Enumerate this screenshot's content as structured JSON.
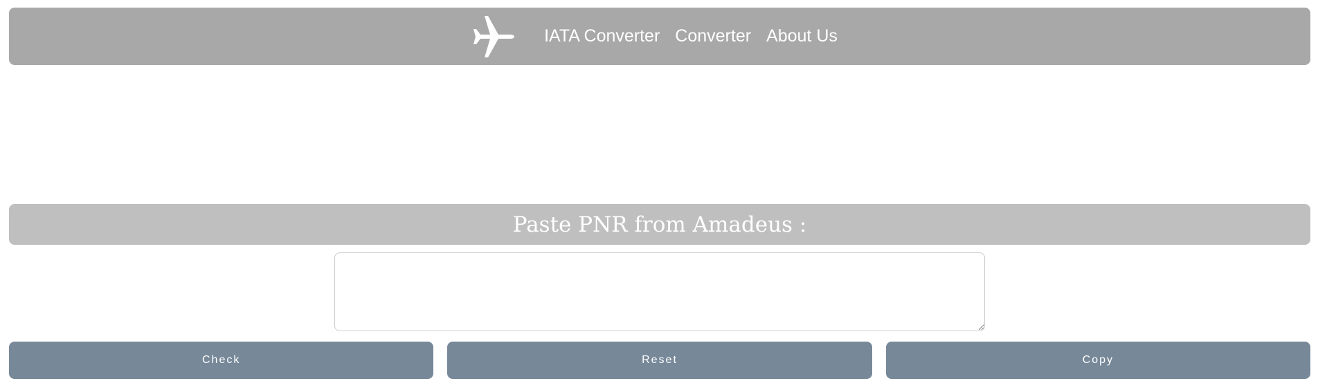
{
  "navbar": {
    "logo_icon": "airplane-icon",
    "links": [
      {
        "label": "IATA Converter"
      },
      {
        "label": "Converter"
      },
      {
        "label": "About Us"
      }
    ]
  },
  "section": {
    "title": "Paste PNR from Amadeus :"
  },
  "pnr_input": {
    "value": "",
    "placeholder": ""
  },
  "buttons": {
    "check_label": "Check",
    "reset_label": "Reset",
    "copy_label": "Copy"
  },
  "colors": {
    "navbar_bg": "#a8a8a8",
    "section_bg": "#bfbfbf",
    "button_bg": "#778899",
    "text_on_dark": "#ffffff"
  }
}
